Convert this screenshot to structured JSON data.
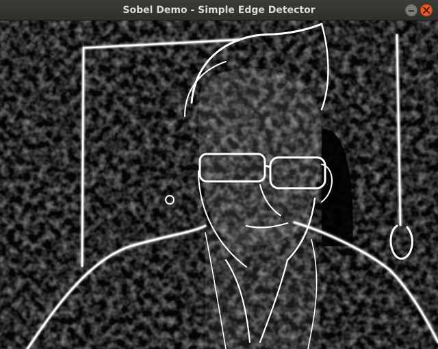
{
  "window": {
    "title": "Sobel Demo - Simple Edge Detector",
    "controls": {
      "minimize_icon": "minimize-icon",
      "close_icon": "close-icon",
      "close_color": "#e9592a"
    }
  },
  "canvas": {
    "description_icon": "sobel-edge-output",
    "background_color": "#000000",
    "edge_color": "#ffffff"
  }
}
